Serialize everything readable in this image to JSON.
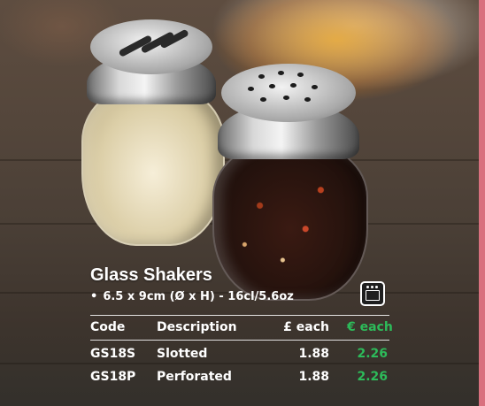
{
  "product": {
    "title": "Glass Shakers",
    "spec_bullet": "•",
    "spec": "6.5 x 9cm (Ø x H) - 16cl/5.6oz",
    "badge_icon": "oven-icon"
  },
  "table": {
    "headers": {
      "code": "Code",
      "description": "Description",
      "gbp": "£ each",
      "eur": "€ each"
    },
    "rows": [
      {
        "code": "GS18S",
        "description": "Slotted",
        "gbp": "1.88",
        "eur": "2.26"
      },
      {
        "code": "GS18P",
        "description": "Perforated",
        "gbp": "1.88",
        "eur": "2.26"
      }
    ]
  },
  "colors": {
    "euro_green": "#2dbb5a",
    "border_pink": "#d9707e",
    "text": "#ffffff"
  }
}
